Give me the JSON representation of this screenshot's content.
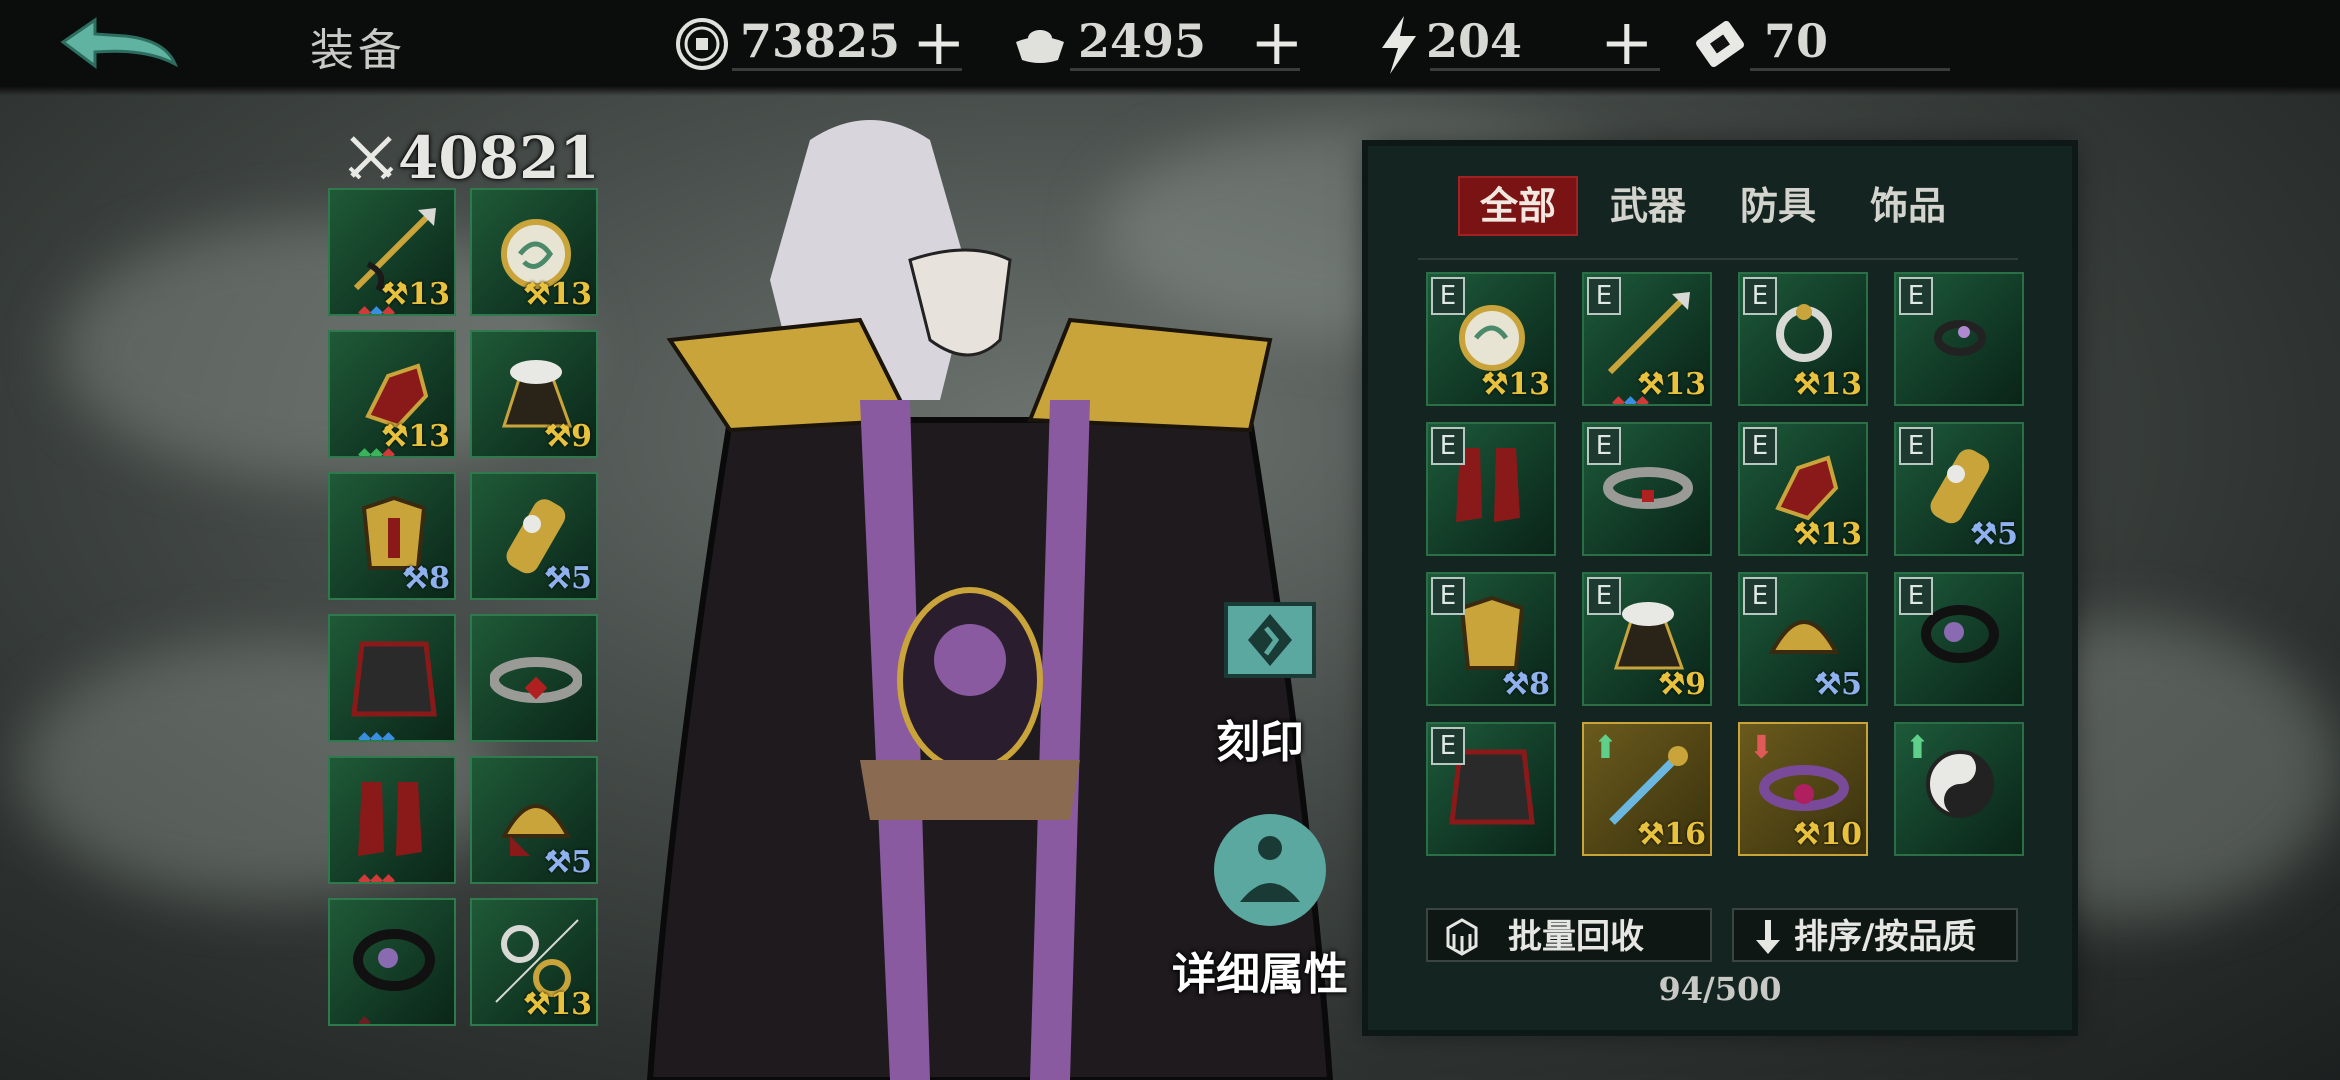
{
  "header": {
    "title": "装备",
    "back_icon": "back-arrow-icon"
  },
  "resources": [
    {
      "icon": "coin-icon",
      "value": "73825"
    },
    {
      "icon": "silver-ingot-icon",
      "value": "2495"
    },
    {
      "icon": "lightning-energy-icon",
      "value": "204"
    },
    {
      "icon": "ticket-icon",
      "value": "70"
    }
  ],
  "plus_label": "+",
  "power": {
    "icon": "crossed-swords-icon",
    "value": "40821"
  },
  "equipped": [
    {
      "name": "spear",
      "level": "13",
      "color": "gold"
    },
    {
      "name": "jade-dragon-pendant",
      "level": "13",
      "color": "gold"
    },
    {
      "name": "red-gauntlet",
      "level": "13",
      "color": "gold"
    },
    {
      "name": "fur-cloak",
      "level": "9",
      "color": "gold"
    },
    {
      "name": "golden-armor",
      "level": "8",
      "color": "blue"
    },
    {
      "name": "golden-bracer",
      "level": "5",
      "color": "blue"
    },
    {
      "name": "dark-skirt",
      "level": "",
      "color": "gold"
    },
    {
      "name": "jeweled-belt",
      "level": "",
      "color": "gold"
    },
    {
      "name": "red-boots",
      "level": "",
      "color": "gold"
    },
    {
      "name": "golden-helmet",
      "level": "5",
      "color": "blue"
    },
    {
      "name": "black-necklace",
      "level": "",
      "color": "gold"
    },
    {
      "name": "ring-pair",
      "level": "13",
      "color": "gold"
    }
  ],
  "actions": {
    "engrave": {
      "label": "刻印",
      "icon": "engrave-seal-icon"
    },
    "details": {
      "label": "详细属性",
      "icon": "meditation-figure-icon"
    }
  },
  "panel": {
    "tabs": [
      {
        "label": "全部",
        "active": true
      },
      {
        "label": "武器",
        "active": false
      },
      {
        "label": "防具",
        "active": false
      },
      {
        "label": "饰品",
        "active": false
      }
    ],
    "equipped_badge": "E",
    "items": [
      {
        "name": "jade-dragon-pendant",
        "badge": "E",
        "level": "13",
        "color": "gold"
      },
      {
        "name": "spear",
        "badge": "E",
        "level": "13",
        "color": "gold"
      },
      {
        "name": "ring",
        "badge": "E",
        "level": "13",
        "color": "gold"
      },
      {
        "name": "dark-ring",
        "badge": "E",
        "level": "",
        "color": "gold"
      },
      {
        "name": "red-boots",
        "badge": "E",
        "level": "",
        "color": "gold"
      },
      {
        "name": "jeweled-belt",
        "badge": "E",
        "level": "",
        "color": "gold"
      },
      {
        "name": "red-gauntlet",
        "badge": "E",
        "level": "13",
        "color": "gold"
      },
      {
        "name": "golden-bracer",
        "badge": "E",
        "level": "5",
        "color": "blue"
      },
      {
        "name": "golden-armor",
        "badge": "E",
        "level": "8",
        "color": "blue"
      },
      {
        "name": "fur-cloak",
        "badge": "E",
        "level": "9",
        "color": "gold"
      },
      {
        "name": "golden-helmet",
        "badge": "E",
        "level": "5",
        "color": "blue"
      },
      {
        "name": "black-necklace",
        "badge": "E",
        "level": "",
        "color": "gold"
      },
      {
        "name": "dark-skirt",
        "badge": "E",
        "level": "",
        "color": "gold"
      },
      {
        "name": "staff",
        "badge": "",
        "arrow": "up",
        "level": "16",
        "color": "gold",
        "rarity": "gold"
      },
      {
        "name": "demon-belt",
        "badge": "",
        "arrow": "down",
        "level": "10",
        "color": "gold",
        "rarity": "gold"
      },
      {
        "name": "yin-yang-amulet",
        "badge": "",
        "arrow": "up",
        "level": "",
        "color": "gold"
      }
    ],
    "recycle_button": {
      "label": "批量回收",
      "icon": "recycle-box-icon"
    },
    "sort_button": {
      "label": "排序/按品质",
      "icon": "sort-down-arrow-icon"
    },
    "capacity": "94/500"
  },
  "colors": {
    "accent_red": "#7a1414",
    "level_gold": "#e8c23c",
    "level_blue": "#8fb2ef",
    "slot_green": "#1f5a37"
  }
}
